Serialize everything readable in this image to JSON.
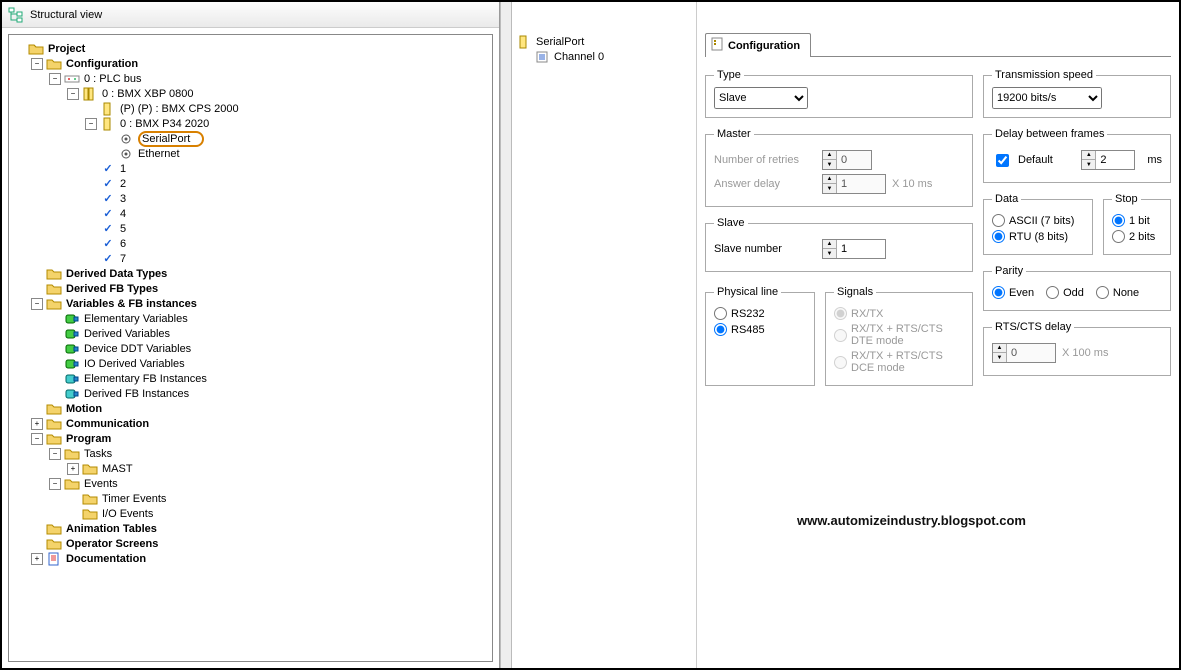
{
  "title": "Structural view",
  "tree": {
    "project": "Project",
    "configuration": "Configuration",
    "plc_bus": "0 : PLC bus",
    "rack": "0 : BMX XBP 0800",
    "cps": "(P) (P) : BMX CPS 2000",
    "cpu": "0 : BMX P34 2020",
    "serialport": "SerialPort",
    "ethernet": "Ethernet",
    "slots": [
      "1",
      "2",
      "3",
      "4",
      "5",
      "6",
      "7"
    ],
    "derived_data": "Derived Data Types",
    "derived_fb": "Derived FB Types",
    "vars_fb": "Variables & FB instances",
    "el_vars": "Elementary Variables",
    "der_vars": "Derived Variables",
    "ddt_vars": "Device DDT Variables",
    "io_der": "IO Derived Variables",
    "el_fb": "Elementary FB Instances",
    "der_fbi": "Derived FB Instances",
    "motion": "Motion",
    "comm": "Communication",
    "program": "Program",
    "tasks": "Tasks",
    "mast": "MAST",
    "events": "Events",
    "timer": "Timer Events",
    "ioev": "I/O Events",
    "anim": "Animation Tables",
    "opscr": "Operator Screens",
    "doc": "Documentation"
  },
  "right_tree": {
    "root": "SerialPort",
    "channel": "Channel 0"
  },
  "tabs": {
    "configuration": "Configuration"
  },
  "cfg": {
    "type": {
      "legend": "Type",
      "value": "Slave"
    },
    "master": {
      "legend": "Master",
      "retries": {
        "label": "Number of retries",
        "value": "0"
      },
      "delay": {
        "label": "Answer delay",
        "value": "1",
        "unit": "X 10 ms"
      }
    },
    "slave": {
      "legend": "Slave",
      "num": {
        "label": "Slave number",
        "value": "1"
      }
    },
    "speed": {
      "legend": "Transmission speed",
      "value": "19200 bits/s"
    },
    "delayFrames": {
      "legend": "Delay between frames",
      "default": "Default",
      "value": "2",
      "unit": "ms"
    },
    "data": {
      "legend": "Data",
      "ascii": "ASCII (7 bits)",
      "rtu": "RTU (8 bits)"
    },
    "stop": {
      "legend": "Stop",
      "one": "1 bit",
      "two": "2 bits"
    },
    "parity": {
      "legend": "Parity",
      "even": "Even",
      "odd": "Odd",
      "none": "None"
    },
    "rts": {
      "legend": "RTS/CTS delay",
      "value": "0",
      "unit": "X 100 ms"
    },
    "phys": {
      "legend": "Physical line",
      "rs232": "RS232",
      "rs485": "RS485"
    },
    "signals": {
      "legend": "Signals",
      "rxtx": "RX/TX",
      "dte": "RX/TX + RTS/CTS DTE mode",
      "dce": "RX/TX + RTS/CTS DCE mode"
    }
  },
  "watermark": "www.automizeindustry.blogspot.com"
}
